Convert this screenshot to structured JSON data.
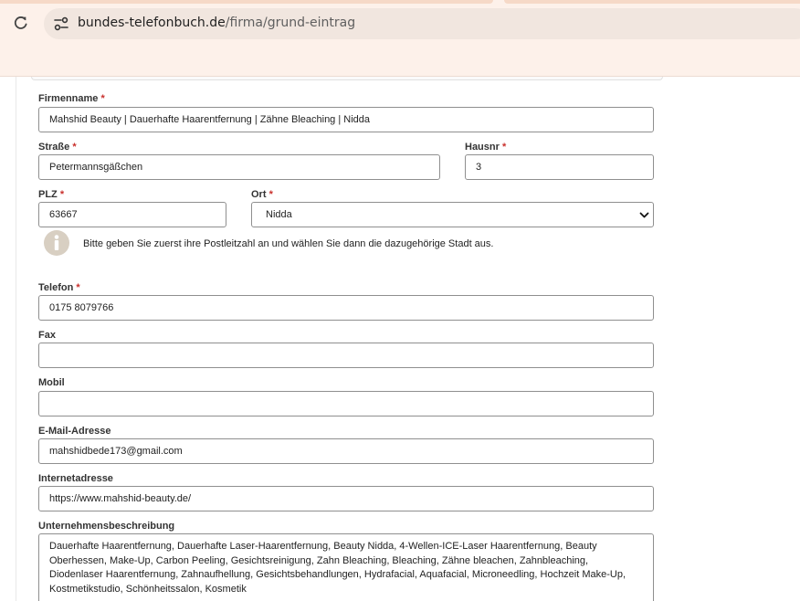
{
  "browser": {
    "url_domain": "bundes-telefonbuch.de",
    "url_path": "/firma/grund-eintrag"
  },
  "form": {
    "firmenname": {
      "label": "Firmenname",
      "required": "*",
      "value": "Mahshid Beauty | Dauerhafte Haarentfernung | Zähne Bleaching | Nidda"
    },
    "strasse": {
      "label": "Straße",
      "required": "*",
      "value": "Petermannsgäßchen"
    },
    "hausnr": {
      "label": "Hausnr",
      "required": "*",
      "value": "3"
    },
    "plz": {
      "label": "PLZ",
      "required": "*",
      "value": "63667"
    },
    "ort": {
      "label": "Ort",
      "required": "*",
      "value": "Nidda"
    },
    "hint": "Bitte geben Sie zuerst ihre Postleitzahl an und wählen Sie dann die dazugehörige Stadt aus.",
    "telefon": {
      "label": "Telefon",
      "required": "*",
      "value": "0175 8079766"
    },
    "fax": {
      "label": "Fax",
      "value": ""
    },
    "mobil": {
      "label": "Mobil",
      "value": ""
    },
    "email": {
      "label": "E-Mail-Adresse",
      "value": "mahshidbede173@gmail.com"
    },
    "internet": {
      "label": "Internetadresse",
      "value": "https://www.mahshid-beauty.de/"
    },
    "beschreibung": {
      "label": "Unternehmensbeschreibung",
      "value": "Dauerhafte Haarentfernung, Dauerhafte Laser-Haarentfernung, Beauty Nidda, 4-Wellen-ICE-Laser Haarentfernung, Beauty Oberhessen, Make-Up, Carbon Peeling, Gesichtsreinigung, Zahn Bleaching, Bleaching, Zähne bleachen, Zahnbleaching, Diodenlaser Haarentfernung, Zahnaufhellung, Gesichtsbehandlungen, Hydrafacial, Aquafacial, Microneedling, Hochzeit Make-Up, Kostmetikstudio, Schönheitssalon, Kosmetik"
    }
  },
  "colors": {
    "required": "#c9302c",
    "browser_bar": "#fdf1ea",
    "info_icon": "#d8cfc2"
  }
}
